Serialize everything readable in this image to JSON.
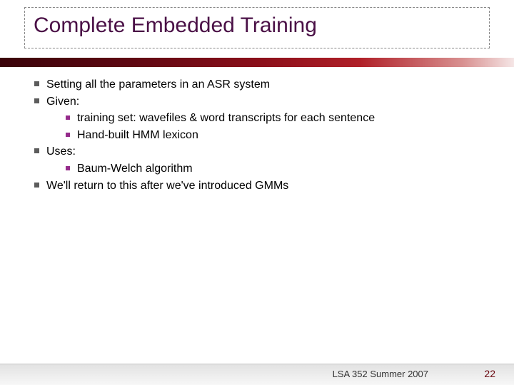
{
  "title": "Complete Embedded Training",
  "bullets": [
    {
      "text": "Setting all the parameters in an ASR system"
    },
    {
      "text": "Given:",
      "sub": [
        "training set: wavefiles & word transcripts for each sentence",
        "Hand-built HMM lexicon"
      ]
    },
    {
      "text": "Uses:",
      "sub": [
        "Baum-Welch algorithm"
      ]
    },
    {
      "text": "We'll return to this after we've introduced GMMs"
    }
  ],
  "footer": "LSA 352 Summer 2007",
  "page_number": "22"
}
